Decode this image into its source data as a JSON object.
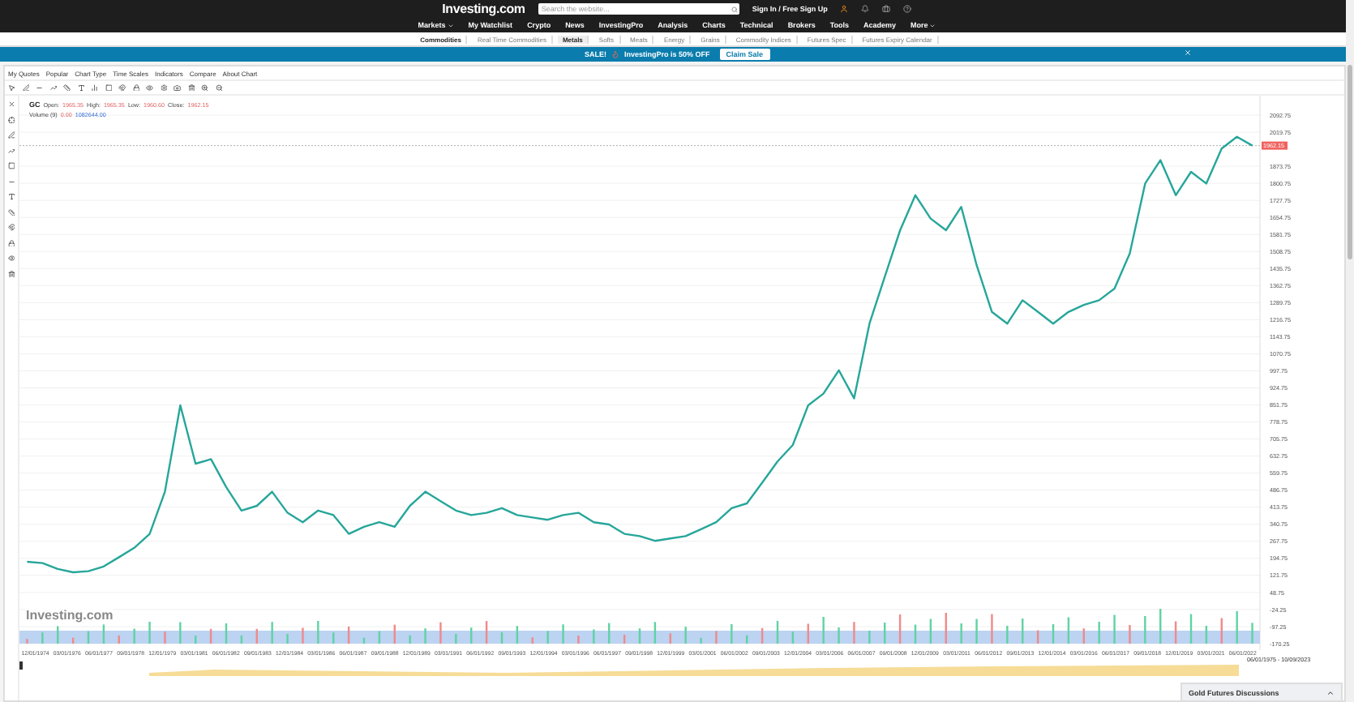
{
  "header": {
    "logo": "Investing.com",
    "search": {
      "placeholder": "Search the website..."
    },
    "sign_in": "Sign In / Free Sign Up"
  },
  "nav": [
    {
      "label": "Markets",
      "has_menu": true
    },
    {
      "label": "My Watchlist",
      "has_menu": false
    },
    {
      "label": "Crypto",
      "has_menu": false
    },
    {
      "label": "News",
      "has_menu": false
    },
    {
      "label": "InvestingPro",
      "has_menu": false
    },
    {
      "label": "Analysis",
      "has_menu": false
    },
    {
      "label": "Charts",
      "has_menu": false
    },
    {
      "label": "Technical",
      "has_menu": false
    },
    {
      "label": "Brokers",
      "has_menu": false
    },
    {
      "label": "Tools",
      "has_menu": false
    },
    {
      "label": "Academy",
      "has_menu": false
    },
    {
      "label": "More",
      "has_menu": true
    }
  ],
  "subnav": [
    {
      "label": "Commodities",
      "kind": "section",
      "selected": false
    },
    {
      "label": "Real Time Commodities",
      "kind": "link",
      "selected": false
    },
    {
      "label": "Metals",
      "kind": "link",
      "selected": true
    },
    {
      "label": "Softs",
      "kind": "link",
      "selected": false
    },
    {
      "label": "Meats",
      "kind": "link",
      "selected": false
    },
    {
      "label": "Energy",
      "kind": "link",
      "selected": false
    },
    {
      "label": "Grains",
      "kind": "link",
      "selected": false
    },
    {
      "label": "Commodity Indices",
      "kind": "link",
      "selected": false
    },
    {
      "label": "Futures Spec",
      "kind": "link",
      "selected": false
    },
    {
      "label": "Futures Expiry Calendar",
      "kind": "link",
      "selected": false
    }
  ],
  "banner": {
    "sale": "SALE!",
    "offer": "InvestingPro is 50% OFF",
    "button": "Claim Sale"
  },
  "chart_menu": [
    "My Quotes",
    "Popular",
    "Chart Type",
    "Time Scales",
    "Indicators",
    "Compare",
    "About Chart"
  ],
  "chart": {
    "ohlc": [
      {
        "label": "Open:",
        "value": "1965.35"
      },
      {
        "label": "High:",
        "value": "1965.35"
      },
      {
        "label": "Low:",
        "value": "1960.60"
      },
      {
        "label": "Close:",
        "value": "1962.15"
      }
    ],
    "volume_label": "Volume (9)",
    "volume_values": [
      "0.00",
      "1082644.00"
    ],
    "watermark": "Investing.com",
    "range": "06/01/1975 - 10/09/2023",
    "x_labels": [
      "12/01/1974",
      "03/01/1976",
      "06/01/1977",
      "09/01/1978",
      "12/01/1979",
      "03/01/1981",
      "06/01/1982",
      "09/01/1983",
      "12/01/1984",
      "03/01/1986",
      "06/01/1987",
      "09/01/1988",
      "12/01/1989",
      "03/01/1991",
      "06/01/1992",
      "09/01/1993",
      "12/01/1994",
      "03/01/1996",
      "06/01/1997",
      "09/01/1998",
      "12/01/1999",
      "03/01/2001",
      "06/01/2002",
      "09/01/2003",
      "12/01/2004",
      "03/01/2006",
      "06/01/2007",
      "09/01/2008",
      "12/01/2009",
      "03/01/2011",
      "06/01/2012",
      "09/01/2013",
      "12/01/2014",
      "03/01/2016",
      "06/01/2017",
      "09/01/2018",
      "12/01/2019",
      "03/01/2021",
      "06/01/2022"
    ],
    "chart_data": {
      "type": "line",
      "grid": true,
      "ref_lines": [
        {
          "axis": "y",
          "value": 1962.15,
          "label": "1962.15"
        }
      ],
      "ylim": [
        -170.25,
        2092.75
      ],
      "yticks": [
        2092.75,
        2019.75,
        1873.75,
        1800.75,
        1727.75,
        1654.75,
        1581.75,
        1508.75,
        1435.75,
        1362.75,
        1289.75,
        1216.75,
        1143.75,
        1070.75,
        997.75,
        924.75,
        851.75,
        778.75,
        705.75,
        632.75,
        559.75,
        486.75,
        413.75,
        340.75,
        267.75,
        194.75,
        121.75,
        48.75,
        -24.25,
        -97.25,
        -170.25
      ],
      "series": [
        {
          "name": "GC",
          "color": "#26a69a",
          "values": [
            180,
            175,
            150,
            135,
            140,
            160,
            200,
            240,
            300,
            480,
            850,
            600,
            620,
            500,
            400,
            420,
            480,
            390,
            350,
            400,
            380,
            300,
            330,
            350,
            330,
            420,
            480,
            440,
            400,
            380,
            390,
            410,
            380,
            370,
            360,
            380,
            390,
            350,
            340,
            300,
            290,
            270,
            280,
            290,
            320,
            350,
            410,
            430,
            520,
            610,
            680,
            850,
            900,
            1000,
            880,
            1200,
            1400,
            1600,
            1750,
            1650,
            1600,
            1700,
            1450,
            1250,
            1200,
            1300,
            1250,
            1200,
            1250,
            1280,
            1300,
            1350,
            1500,
            1800,
            1900,
            1750,
            1850,
            1800,
            1950,
            2000,
            1962
          ]
        }
      ]
    }
  },
  "discussion": {
    "title": "Gold Futures Discussions"
  }
}
